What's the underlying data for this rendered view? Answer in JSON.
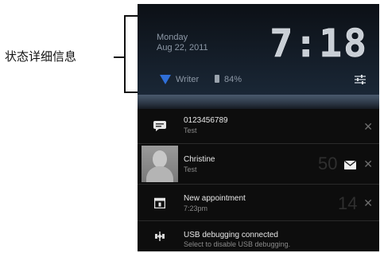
{
  "annotation": {
    "label": "状态详细信息"
  },
  "status_panel": {
    "day": "Monday",
    "date": "Aug 22, 2011",
    "time": "7:18",
    "network": "Writer",
    "battery": "84%"
  },
  "notifications": [
    {
      "title": "0123456789",
      "subtitle": "Test",
      "count": "",
      "icon": "message-icon"
    },
    {
      "title": "Christine",
      "subtitle": "Test",
      "count": "50",
      "icon": "contact-avatar"
    },
    {
      "title": "New appointment",
      "subtitle": "7:23pm",
      "count": "14",
      "icon": "calendar-icon"
    },
    {
      "title": "USB debugging connected",
      "subtitle": "Select to disable USB debugging.",
      "count": "",
      "icon": "usb-icon"
    }
  ],
  "colors": {
    "wifi": "#2f6fd8",
    "panel_bg": "#0d0d0d"
  }
}
